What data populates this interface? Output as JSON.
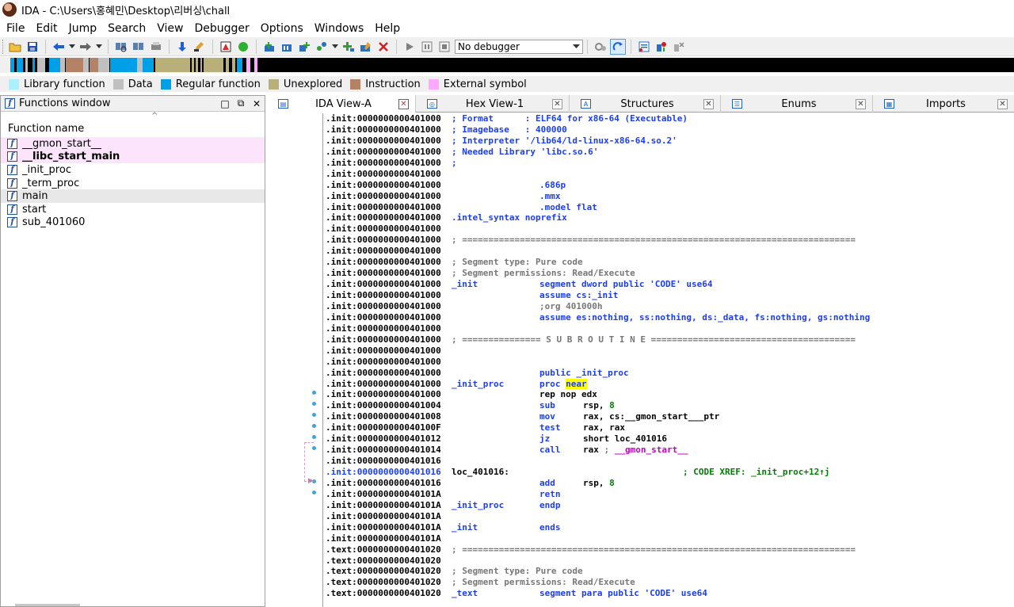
{
  "window": {
    "title": "IDA - C:\\Users\\홍혜민\\Desktop\\리버싱\\chall"
  },
  "menu": [
    "File",
    "Edit",
    "Jump",
    "Search",
    "View",
    "Debugger",
    "Options",
    "Windows",
    "Help"
  ],
  "toolbar": {
    "debugger_select": "No debugger"
  },
  "legend": [
    {
      "label": "Library function",
      "color": "#aaf0ff"
    },
    {
      "label": "Data",
      "color": "#c0c0c0"
    },
    {
      "label": "Regular function",
      "color": "#00a0e8"
    },
    {
      "label": "Unexplored",
      "color": "#b8b078"
    },
    {
      "label": "Instruction",
      "color": "#b48264"
    },
    {
      "label": "External symbol",
      "color": "#ffa8ff"
    }
  ],
  "functions_window": {
    "title": "Functions window",
    "column": "Function name",
    "items": [
      "__gmon_start__",
      "__libc_start_main",
      "_init_proc",
      "_term_proc",
      "main",
      "start",
      "sub_401060"
    ]
  },
  "tabs": [
    {
      "label": "IDA View-A",
      "icon": "ida-view-icon"
    },
    {
      "label": "Hex View-1",
      "icon": "hex-view-icon"
    },
    {
      "label": "Structures",
      "icon": "structures-icon"
    },
    {
      "label": "Enums",
      "icon": "enums-icon"
    },
    {
      "label": "Imports",
      "icon": "imports-icon"
    }
  ],
  "listing": [
    {
      "a": ".init:0000000000401000",
      "c": "; Format      : ELF64 for x86-64 (Executable)"
    },
    {
      "a": ".init:0000000000401000",
      "c": "; Imagebase   : 400000"
    },
    {
      "a": ".init:0000000000401000",
      "c": "; Interpreter '/lib64/ld-linux-x86-64.so.2'"
    },
    {
      "a": ".init:0000000000401000",
      "c": "; Needed Library 'libc.so.6'"
    },
    {
      "a": ".init:0000000000401000",
      "c": ";"
    },
    {
      "a": ".init:0000000000401000"
    },
    {
      "a": ".init:0000000000401000",
      "d": ".686p"
    },
    {
      "a": ".init:0000000000401000",
      "d": ".mmx"
    },
    {
      "a": ".init:0000000000401000",
      "d": ".model flat"
    },
    {
      "a": ".init:0000000000401000",
      "c": ".intel_syntax noprefix"
    },
    {
      "a": ".init:0000000000401000"
    },
    {
      "a": ".init:0000000000401000",
      "s": "; ==========================================================================="
    },
    {
      "a": ".init:0000000000401000"
    },
    {
      "a": ".init:0000000000401000",
      "cg": "; Segment type: Pure code"
    },
    {
      "a": ".init:0000000000401000",
      "cg": "; Segment permissions: Read/Execute"
    },
    {
      "a": ".init:0000000000401000",
      "l": "_init",
      "d": "segment dword public 'CODE' use64"
    },
    {
      "a": ".init:0000000000401000",
      "d": "assume cs:_init"
    },
    {
      "a": ".init:0000000000401000",
      "dg": ";org 401000h"
    },
    {
      "a": ".init:0000000000401000",
      "d": "assume es:nothing, ss:nothing, ds:_data, fs:nothing, gs:nothing"
    },
    {
      "a": ".init:0000000000401000"
    },
    {
      "a": ".init:0000000000401000",
      "s": "; =============== S U B R O U T I N E ======================================="
    },
    {
      "a": ".init:0000000000401000"
    },
    {
      "a": ".init:0000000000401000"
    },
    {
      "a": ".init:0000000000401000",
      "d": "public _init_proc"
    },
    {
      "a": ".init:0000000000401000",
      "l": "_init_proc",
      "d": "proc ",
      "dh": "near"
    },
    {
      "a": ".init:0000000000401000",
      "i": "rep nop edx"
    },
    {
      "a": ".init:0000000000401004",
      "i": "sub",
      "o": "rsp, ",
      "og": "8"
    },
    {
      "a": ".init:0000000000401008",
      "i": "mov",
      "o": "rax, cs:__gmon_start___ptr"
    },
    {
      "a": ".init:000000000040100F",
      "i": "test",
      "o": "rax, rax"
    },
    {
      "a": ".init:0000000000401012",
      "i": "jz",
      "o": "short loc_401016"
    },
    {
      "a": ".init:0000000000401014",
      "i": "call",
      "o": "rax ",
      "oc": "; ",
      "op": "__gmon_start__"
    },
    {
      "a": ".init:0000000000401016"
    },
    {
      "a": ".init:0000000000401016",
      "hi": true,
      "lb": "loc_401016:",
      "x": "; CODE XREF: _init_proc+12↑j"
    },
    {
      "a": ".init:0000000000401016",
      "i": "add",
      "o": "rsp, ",
      "og": "8"
    },
    {
      "a": ".init:000000000040101A",
      "i": "retn"
    },
    {
      "a": ".init:000000000040101A",
      "l": "_init_proc",
      "d": "endp"
    },
    {
      "a": ".init:000000000040101A"
    },
    {
      "a": ".init:000000000040101A",
      "l": "_init",
      "d": "ends"
    },
    {
      "a": ".init:000000000040101A"
    },
    {
      "a": ".text:0000000000401020",
      "s": "; ==========================================================================="
    },
    {
      "a": ".text:0000000000401020"
    },
    {
      "a": ".text:0000000000401020",
      "cg": "; Segment type: Pure code"
    },
    {
      "a": ".text:0000000000401020",
      "cg": "; Segment permissions: Read/Execute"
    },
    {
      "a": ".text:0000000000401020",
      "l": "_text",
      "d": "segment para public 'CODE' use64"
    }
  ]
}
